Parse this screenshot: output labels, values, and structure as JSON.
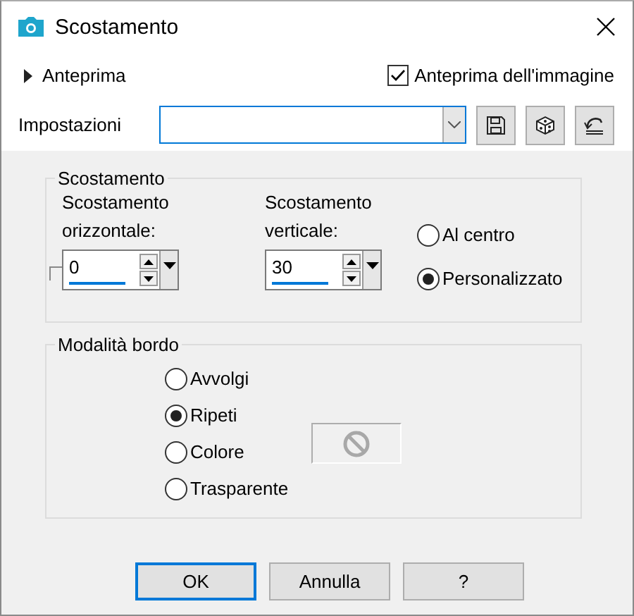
{
  "window": {
    "title": "Scostamento"
  },
  "preview": {
    "label": "Anteprima",
    "expanded": false
  },
  "image_preview": {
    "label": "Anteprima dell'immagine",
    "checked": true
  },
  "settings": {
    "label": "Impostazioni"
  },
  "offset": {
    "title": "Scostamento",
    "fields": [
      {
        "label": "Scostamento orizzontale:",
        "value": "0"
      },
      {
        "label": "Scostamento verticale:",
        "value": "30"
      }
    ],
    "modes": [
      {
        "label": "Al centro",
        "selected": false
      },
      {
        "label": "Personalizzato",
        "selected": true
      }
    ]
  },
  "edge_mode": {
    "title": "Modalità bordo",
    "options": [
      {
        "label": "Avvolgi",
        "selected": false
      },
      {
        "label": "Ripeti",
        "selected": true
      },
      {
        "label": "Colore",
        "selected": false
      },
      {
        "label": "Trasparente",
        "selected": false
      }
    ]
  },
  "buttons": [
    {
      "label": "OK",
      "default": true
    },
    {
      "label": "Annulla",
      "default": false
    },
    {
      "label": "?",
      "default": false
    }
  ]
}
